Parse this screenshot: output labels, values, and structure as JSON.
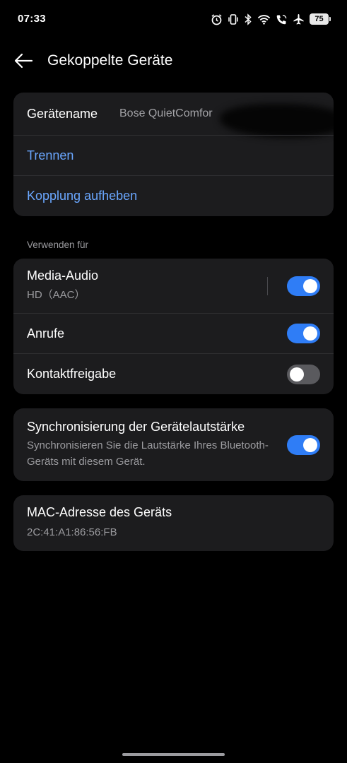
{
  "status_bar": {
    "time": "07:33",
    "icons": [
      "alarm-icon",
      "vibrate-icon",
      "bluetooth-icon",
      "wifi-icon",
      "wifi-calling-icon",
      "airplane-icon"
    ],
    "battery": "75"
  },
  "header": {
    "title": "Gekoppelte Geräte",
    "back_icon": "arrow-left-icon"
  },
  "device_card": {
    "name_label": "Gerätename",
    "name_value": "Bose QuietComfor",
    "disconnect": "Trennen",
    "unpair": "Kopplung aufheben"
  },
  "use_for": {
    "section_title": "Verwenden für",
    "items": [
      {
        "label": "Media-Audio",
        "sub": "HD（AAC）",
        "enabled": true
      },
      {
        "label": "Anrufe",
        "enabled": true
      },
      {
        "label": "Kontaktfreigabe",
        "enabled": false
      }
    ]
  },
  "volume_sync": {
    "label": "Synchronisierung der Gerätelautstärke",
    "description": "Synchronisieren Sie die Lautstärke Ihres Bluetooth-Geräts mit diesem Gerät.",
    "enabled": true
  },
  "mac": {
    "label": "MAC-Adresse des Geräts",
    "value": "2C:41:A1:86:56:FB"
  },
  "colors": {
    "background": "#000000",
    "card": "#1c1c1e",
    "accent": "#2f7df6",
    "link": "#6aa7ff",
    "secondary_text": "#9b9b9f"
  }
}
